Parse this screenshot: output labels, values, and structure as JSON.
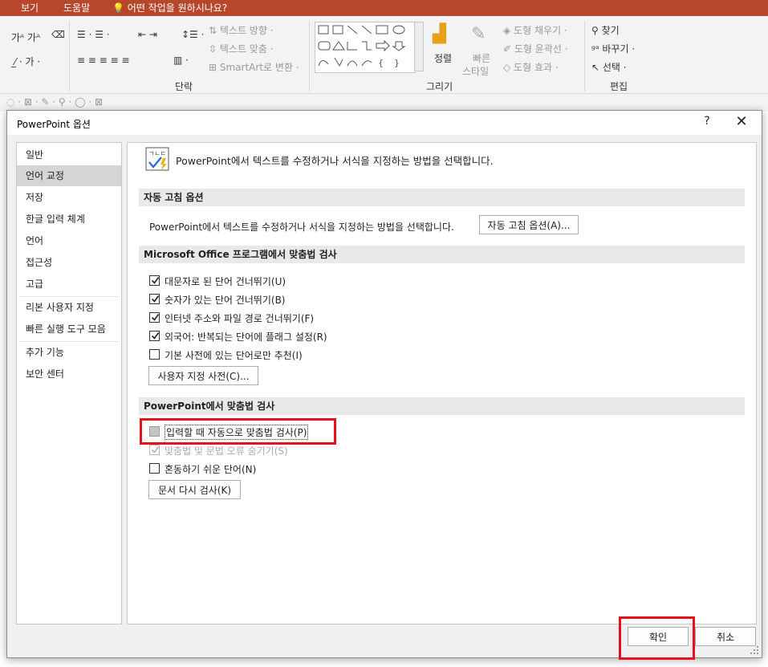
{
  "ribbon": {
    "tabs": [
      "보기",
      "도움말"
    ],
    "tell_me": "어떤 작업을 원하시나요?",
    "groups": {
      "paragraph": "단락",
      "drawing": "그리기",
      "editing": "편집"
    },
    "paragraph": {
      "text_direction": "텍스트 방향",
      "align_text": "텍스트 맞춤",
      "smartart": "SmartArt로 변환"
    },
    "drawing": {
      "arrange": "정렬",
      "quick_styles_1": "빠른",
      "quick_styles_2": "스타일",
      "shape_fill": "도형 채우기",
      "shape_outline": "도형 윤곽선",
      "shape_effects": "도형 효과"
    },
    "editing": {
      "find": "찾기",
      "replace": "바꾸기",
      "select": "선택"
    },
    "colors": {
      "tab_bg": "#b7472a",
      "ribbon_bg": "#f3f3f3"
    }
  },
  "dialog": {
    "title": "PowerPoint 옵션",
    "help": "?",
    "nav": [
      "일반",
      "언어 교정",
      "저장",
      "한글 입력 체계",
      "언어",
      "접근성",
      "고급",
      "리본 사용자 지정",
      "빠른 실행 도구 모음",
      "추가 기능",
      "보안 센터"
    ],
    "active_nav": "언어 교정",
    "header": "PowerPoint에서 텍스트를 수정하거나 서식을 지정하는 방법을 선택합니다.",
    "autocorrect": {
      "section": "자동 고침 옵션",
      "desc": "PowerPoint에서 텍스트를 수정하거나 서식을 지정하는 방법을 선택합니다.",
      "button": "자동 고침 옵션(A)..."
    },
    "office_spell": {
      "section": "Microsoft Office 프로그램에서 맞춤법 검사",
      "checks": [
        {
          "label": "대문자로 된 단어 건너뛰기(U)",
          "checked": true
        },
        {
          "label": "숫자가 있는 단어 건너뛰기(B)",
          "checked": true
        },
        {
          "label": "인터넷 주소와 파일 경로 건너뛰기(F)",
          "checked": true
        },
        {
          "label": "외국어: 반복되는 단어에 플래그 설정(R)",
          "checked": true
        },
        {
          "label": "기본 사전에 있는 단어로만 추천(I)",
          "checked": false
        }
      ],
      "button": "사용자 지정 사전(C)..."
    },
    "ppt_spell": {
      "section": "PowerPoint에서 맞춤법 검사",
      "checks": [
        {
          "label": "입력할 때 자동으로 맞춤법 검사(P)",
          "checked": false,
          "state": "indeterminate"
        },
        {
          "label": "맞춤법 및 문법 오류 숨기기(S)",
          "checked": true,
          "state": "disabled"
        },
        {
          "label": "혼동하기 쉬운 단어(N)",
          "checked": false
        }
      ],
      "button": "문서 다시 검사(K)"
    },
    "ok": "확인",
    "cancel": "취소",
    "highlight_color": "#e3121e"
  }
}
